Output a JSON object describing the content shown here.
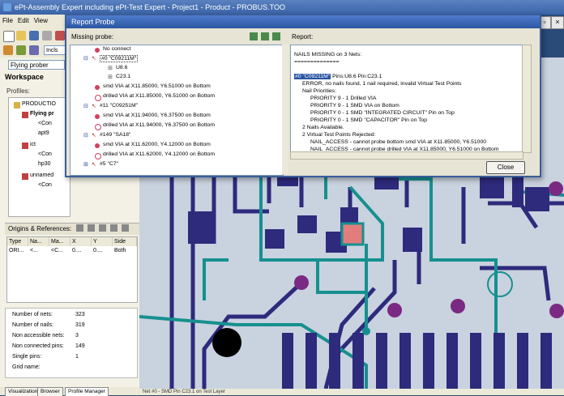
{
  "app": {
    "title": "ePt-Assembly Expert including ePt-Test Expert - Project1 - Product - PROBUS.TOO",
    "menu": [
      "File",
      "Edit",
      "View"
    ],
    "profile_value": "Flying prober",
    "toolbar_field": "Incls"
  },
  "workspace": {
    "title": "Workspace",
    "profiles_label": "Profiles:",
    "tree": [
      {
        "label": "PRODUCTIO",
        "level": 0
      },
      {
        "label": "Flying pr",
        "level": 1
      },
      {
        "label": "<Con",
        "level": 2
      },
      {
        "label": "apt9",
        "level": 2
      },
      {
        "label": "ict",
        "level": 1
      },
      {
        "label": "<Con",
        "level": 2
      },
      {
        "label": "hp30",
        "level": 2
      },
      {
        "label": "unnamed",
        "level": 1
      },
      {
        "label": "<Con",
        "level": 2
      }
    ]
  },
  "origins": {
    "title": "Origins & References:",
    "columns": [
      "Type",
      "Na...",
      "Ma...",
      "X",
      "Y",
      "Side"
    ],
    "rows": [
      [
        "ORI...",
        "<...",
        "<C...",
        "0....",
        "0....",
        "Both"
      ]
    ]
  },
  "stats": [
    {
      "label": "Number of nets:",
      "value": "323"
    },
    {
      "label": "Number of nails:",
      "value": "319"
    },
    {
      "label": "Non accessible nets:",
      "value": "3"
    },
    {
      "label": "Non connected pins:",
      "value": "149"
    },
    {
      "label": "Single pins:",
      "value": "1"
    },
    {
      "label": "Grid name:",
      "value": ""
    }
  ],
  "bottom_tabs": [
    "Visualization",
    "Browser",
    "Profile Manager"
  ],
  "dialog": {
    "title": "Report Probe",
    "missing_label": "Missing probe:",
    "report_label": "Report:",
    "close_label": "Close",
    "missing_items": [
      {
        "text": "No connect",
        "level": 1,
        "icon": "red"
      },
      {
        "text": "#0 \"C09211M\"",
        "level": 0,
        "icon": "net"
      },
      {
        "text": "U8.6",
        "level": 2,
        "icon": "pin"
      },
      {
        "text": "C23.1",
        "level": 2,
        "icon": "pin"
      },
      {
        "text": "smd VIA at X11.85000, Y6.51000 on Bottom",
        "level": 1,
        "icon": "red"
      },
      {
        "text": "drilled VIA at X11.85000, Y6.51000 on Bottom",
        "level": 1,
        "icon": "red"
      },
      {
        "text": "#11 \"C09251M\"",
        "level": 0,
        "icon": "net"
      },
      {
        "text": "smd VIA at X11.94000, Y6.37500 on Bottom",
        "level": 1,
        "icon": "red"
      },
      {
        "text": "drilled VIA at X11.94000, Y6.37500 on Bottom",
        "level": 1,
        "icon": "red"
      },
      {
        "text": "#149 \"SA18\"",
        "level": 0,
        "icon": "net"
      },
      {
        "text": "smd VIA at X11.62000, Y4.12000 on Bottom",
        "level": 1,
        "icon": "red"
      },
      {
        "text": "drilled VIA at X11.62000, Y4.12000 on Bottom",
        "level": 1,
        "icon": "red"
      },
      {
        "text": "#5 \"C7\"",
        "level": 0,
        "icon": "net"
      }
    ],
    "report_lines": [
      {
        "text": "NAILS MISSING on 3 Nets:",
        "indent": 0
      },
      {
        "text": "==============",
        "indent": 0
      },
      {
        "text": "",
        "indent": 0
      },
      {
        "text": "#0 \"C09211M\" Pins:U8.6 Pin:C23.1",
        "indent": 0,
        "highlight": "#0 \"C09211M\""
      },
      {
        "text": "ERROR, no nails found, 1 nail required, invalid Virtual Test Points",
        "indent": 1
      },
      {
        "text": "Nail Priorities:",
        "indent": 1
      },
      {
        "text": "PRIORITY  9 - 1 Drilled VIA",
        "indent": 2
      },
      {
        "text": "PRIORITY  9 - 1 SMD VIA on Bottom",
        "indent": 2
      },
      {
        "text": "PRIORITY  0 - 1 SMD \"INTEGRATED CIRCUIT\" Pin on Top",
        "indent": 2
      },
      {
        "text": "PRIORITY  0 - 1 SMD \"CAPACITOR\" Pin on Top",
        "indent": 2
      },
      {
        "text": "2 Nails Available.",
        "indent": 1
      },
      {
        "text": "2 Virtual Test Points Rejected:",
        "indent": 1
      },
      {
        "text": "NAIL_ACCESS - cannot probe bottom smd VIA at X11.85000, Y6.51000",
        "indent": 2
      },
      {
        "text": "NAIL_ACCESS - cannot probe drilled VIA at X11.85000, Y6.51000 on Bottom",
        "indent": 2
      }
    ]
  },
  "pcb_status": "Net #0 - SMD Pin C23.1 on Test Layer",
  "colors": {
    "board": "#c9d2df",
    "trace_dark": "#2e2a7c",
    "trace_teal": "#16908f",
    "via_purple": "#7a2a82",
    "pad_highlight": "#e37d7d"
  }
}
